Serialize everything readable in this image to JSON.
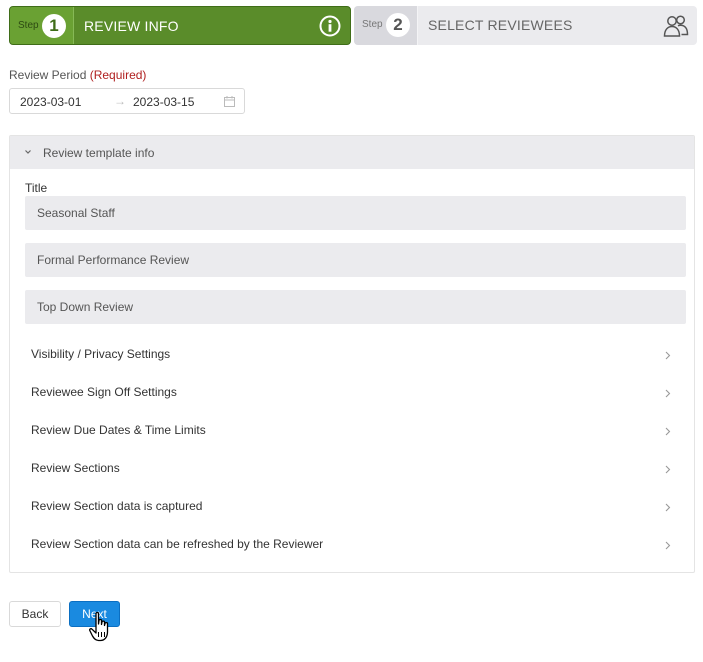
{
  "stepper": {
    "steps": [
      {
        "word": "Step",
        "number": "1",
        "title": "REVIEW INFO",
        "icon": "info-icon",
        "active": true
      },
      {
        "word": "Step",
        "number": "2",
        "title": "SELECT REVIEWEES",
        "icon": "people-icon",
        "active": false
      }
    ],
    "active_color": "#5a8c2a",
    "inactive_color": "#ebebee"
  },
  "review_period": {
    "label": "Review Period",
    "required": "(Required)",
    "start": "2023-03-01",
    "arrow": "→",
    "end": "2023-03-15",
    "icon": "calendar-icon"
  },
  "template_panel": {
    "header": "Review template info",
    "expanded": true,
    "title_label": "Title",
    "fields": [
      "Seasonal Staff",
      "Formal Performance Review",
      "Top Down Review"
    ],
    "settings": [
      "Visibility / Privacy Settings",
      "Reviewee Sign Off Settings",
      "Review Due Dates & Time Limits",
      "Review Sections",
      "Review Section data is captured",
      "Review Section data can be refreshed by the Reviewer"
    ]
  },
  "actions": {
    "back": "Back",
    "next": "Next",
    "primary_color": "#1a8ae0"
  }
}
